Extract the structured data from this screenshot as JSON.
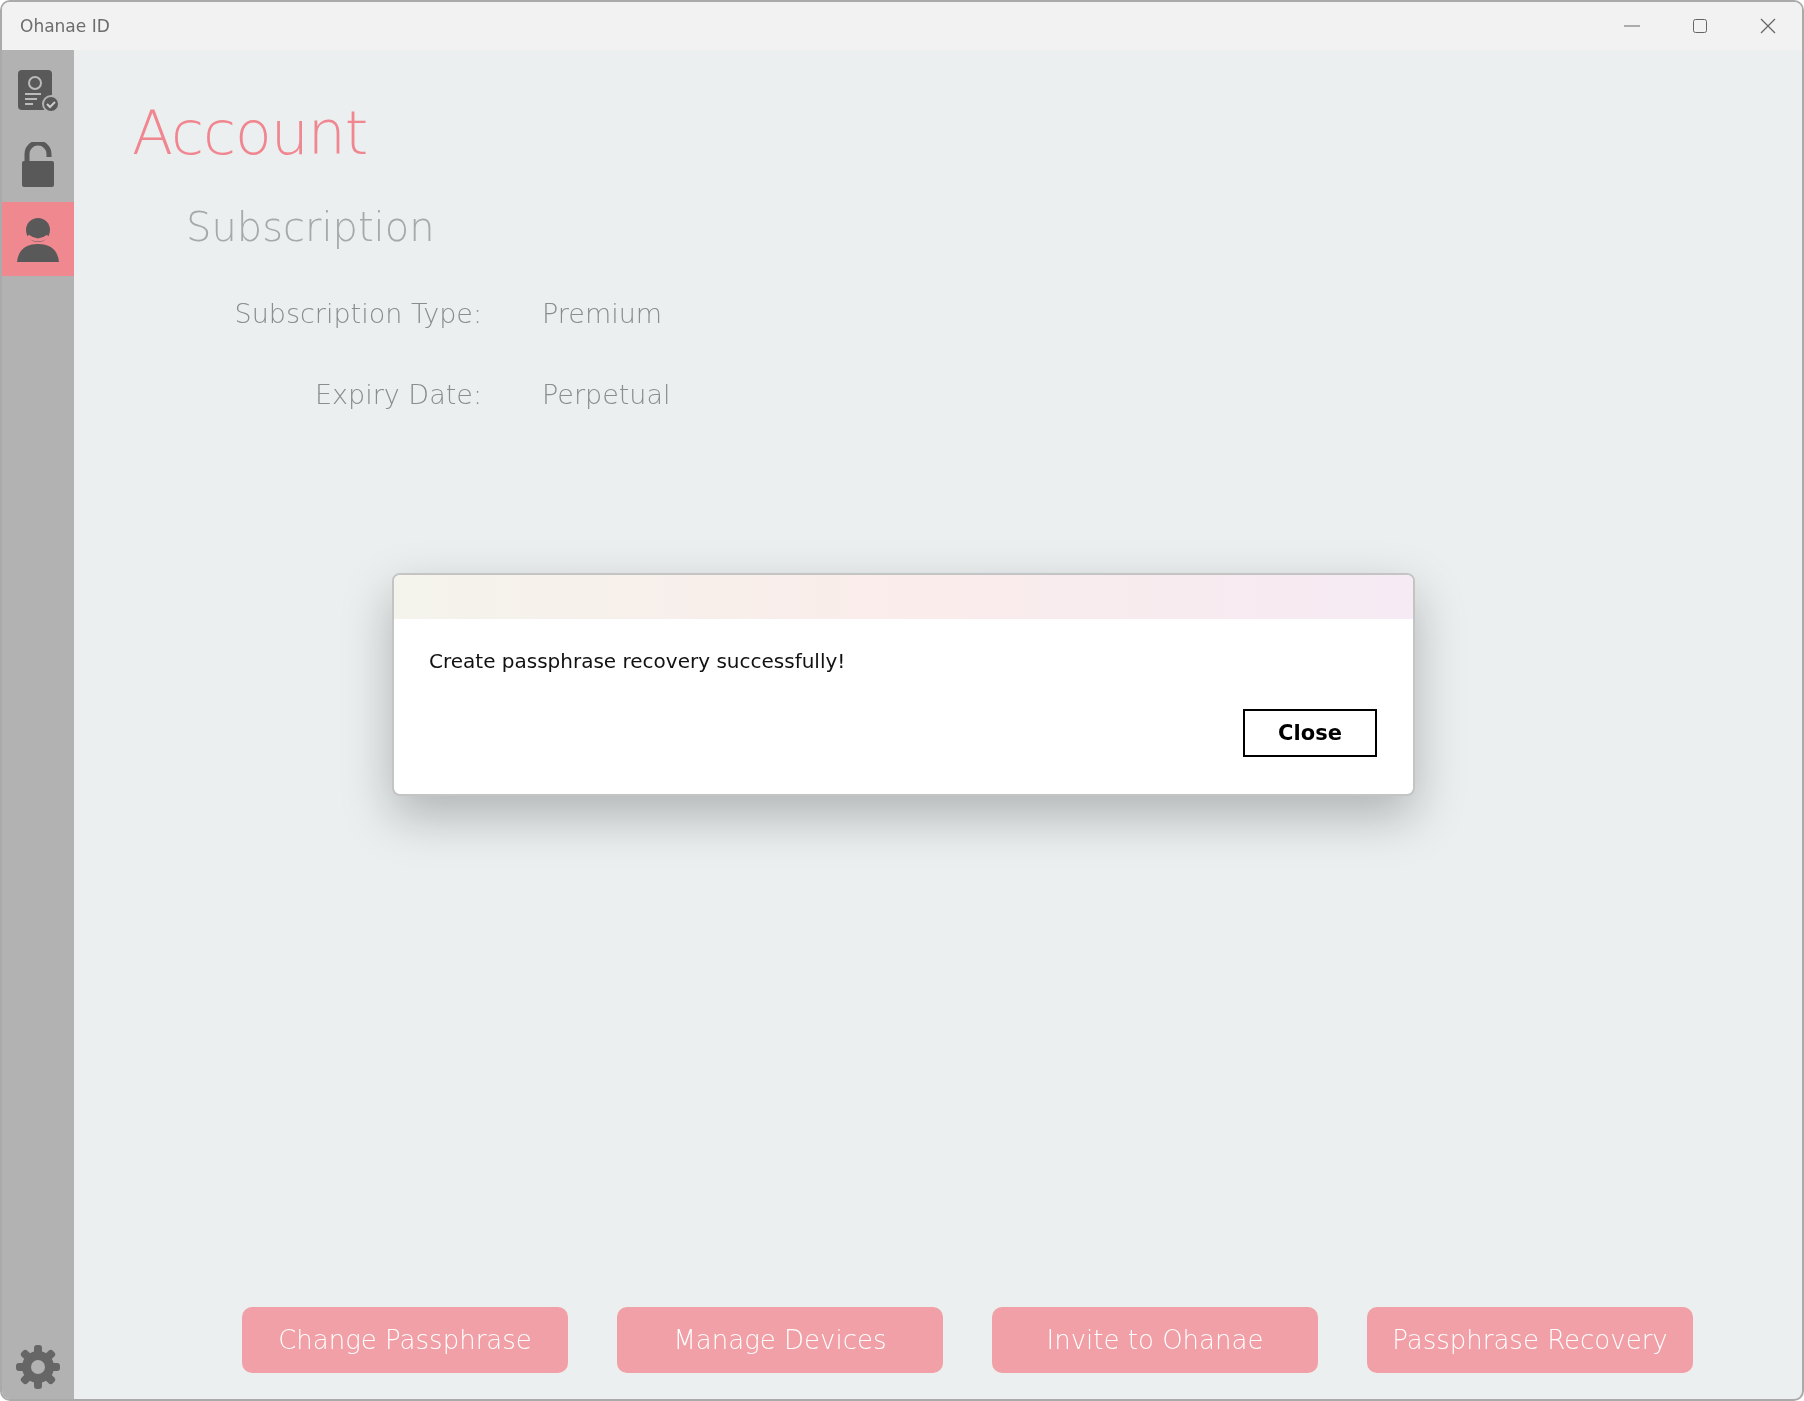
{
  "window": {
    "title": "Ohanae ID"
  },
  "sidebar": {
    "items": [
      {
        "kind": "id-card",
        "selected": false
      },
      {
        "kind": "lock",
        "selected": false
      },
      {
        "kind": "person",
        "selected": true
      }
    ]
  },
  "page": {
    "title": "Account",
    "section": "Subscription",
    "fields": [
      {
        "label": "Subscription Type:",
        "value": "Premium"
      },
      {
        "label": "Expiry Date:",
        "value": "Perpetual"
      }
    ]
  },
  "actions": [
    "Change Passphrase",
    "Manage Devices",
    "Invite to Ohanae",
    "Passphrase Recovery"
  ],
  "dialog": {
    "message": "Create passphrase recovery successfully!",
    "button": "Close"
  }
}
